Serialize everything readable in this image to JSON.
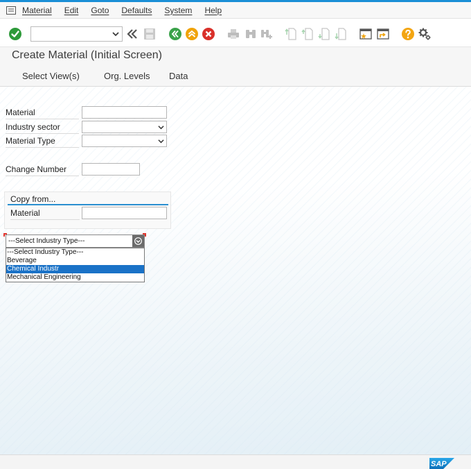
{
  "menubar": {
    "items": [
      "Material",
      "Edit",
      "Goto",
      "Defaults",
      "System",
      "Help"
    ]
  },
  "toolbar": {
    "command_field": {
      "value": ""
    },
    "icons": [
      "enter-check-icon",
      "save-icon",
      "back-icon",
      "exit-icon",
      "cancel-icon",
      "print-icon",
      "find-icon",
      "find-next-icon",
      "first-page-icon",
      "previous-page-icon",
      "next-page-icon",
      "last-page-icon",
      "create-session-icon",
      "shortcut-icon",
      "help-icon",
      "customize-layout-icon"
    ]
  },
  "title": "Create Material (Initial Screen)",
  "app_toolbar": {
    "select_views": "Select View(s)",
    "org_levels": "Org. Levels",
    "data": "Data"
  },
  "form": {
    "material": {
      "label": "Material",
      "value": ""
    },
    "industry_sector": {
      "label": "Industry sector",
      "value": ""
    },
    "material_type": {
      "label": "Material Type",
      "value": ""
    },
    "change_number": {
      "label": "Change Number",
      "value": ""
    }
  },
  "copy_from": {
    "title": "Copy from...",
    "material": {
      "label": "Material",
      "value": ""
    }
  },
  "industry_dropdown": {
    "selected_value": "---Select Industry Type---",
    "options": [
      "---Select Industry Type---",
      "Beverage",
      "Chemical Industr",
      "Mechanical Engineering"
    ],
    "highlighted_index": 2
  },
  "footer": {
    "logo": "SAP"
  },
  "colors": {
    "accent": "#1b8fd6",
    "highlight": "#1a72c7",
    "enter_green": "#2e9a3a",
    "nav_green": "#3aa24a",
    "exit_orange": "#f0a30a",
    "cancel_red": "#d9302a",
    "help_orange": "#f3a512"
  }
}
